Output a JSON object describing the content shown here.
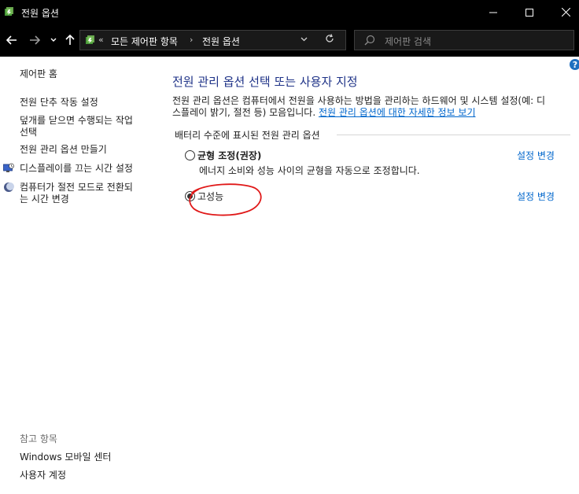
{
  "window": {
    "title": "전원 옵션"
  },
  "address": {
    "overflow": "«",
    "crumbs": [
      "모든 제어판 항목",
      "전원 옵션"
    ]
  },
  "search": {
    "placeholder": "제어판 검색"
  },
  "sidebar": {
    "home": "제어판 홈",
    "tasks": [
      {
        "label": "전원 단추 작동 설정"
      },
      {
        "label": "덮개를 닫으면 수행되는 작업",
        "label2": "선택"
      },
      {
        "label": "전원 관리 옵션 만들기"
      },
      {
        "label": "디스플레이를 끄는 시간 설정",
        "icon": "display-icon"
      },
      {
        "label": "컴퓨터가 절전 모드로 전환되",
        "label2": "는 시간 변경",
        "icon": "moon-icon"
      }
    ],
    "see_also": {
      "heading": "참고 항목",
      "items": [
        "Windows 모바일 센터",
        "사용자 계정"
      ]
    }
  },
  "main": {
    "heading": "전원 관리 옵션 선택 또는 사용자 지정",
    "desc_line1": "전원 관리 옵션은 컴퓨터에서 전원을 사용하는 방법을 관리하는 하드웨어 및 시스템 설정(예: 디",
    "desc_line2": "스플레이 밝기, 절전 등) 모음입니다.",
    "desc_link": "전원 관리 옵션에 대한 자세한 정보 보기",
    "group_label": "배터리 수준에 표시된 전원 관리 옵션",
    "plans": [
      {
        "name": "균형 조정(권장)",
        "description": "에너지 소비와 성능 사이의 균형을 자동으로 조정합니다.",
        "selected": false,
        "link": "설정 변경"
      },
      {
        "name": "고성능",
        "description": "",
        "selected": true,
        "link": "설정 변경"
      }
    ]
  },
  "colors": {
    "titlebar": "#000000",
    "heading": "#1e3287",
    "link": "#0066cc",
    "annotation": "#e01818"
  }
}
